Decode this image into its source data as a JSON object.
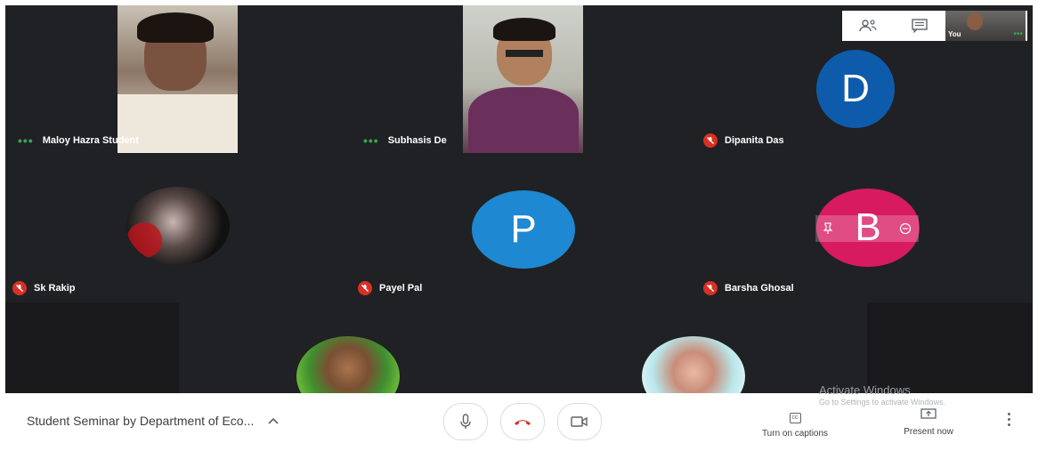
{
  "participants": [
    {
      "name": "Maloy Hazra Student",
      "status": "speaking"
    },
    {
      "name": "Subhasis De",
      "status": "speaking"
    },
    {
      "name": "Dipanita Das",
      "status": "muted",
      "initial": "D",
      "avatar_color": "#0f5bab"
    },
    {
      "name": "Sk Rakip",
      "status": "muted"
    },
    {
      "name": "Payel Pal",
      "status": "muted",
      "initial": "P",
      "avatar_color": "#1e88d2"
    },
    {
      "name": "Barsha Ghosal",
      "status": "muted",
      "initial": "B",
      "avatar_color": "#d81b60"
    }
  ],
  "self_view": {
    "label": "You"
  },
  "meeting": {
    "title": "Student Seminar by Department of Eco..."
  },
  "captions": {
    "label": "Turn on captions",
    "icon": "cc"
  },
  "present": {
    "label": "Present now"
  },
  "watermark": {
    "line1": "Activate Windows",
    "line2": "Go to Settings to activate Windows."
  },
  "colors": {
    "end_call": "#d93025",
    "muted_badge": "#d93025",
    "speaking_dots": "#34a853"
  }
}
